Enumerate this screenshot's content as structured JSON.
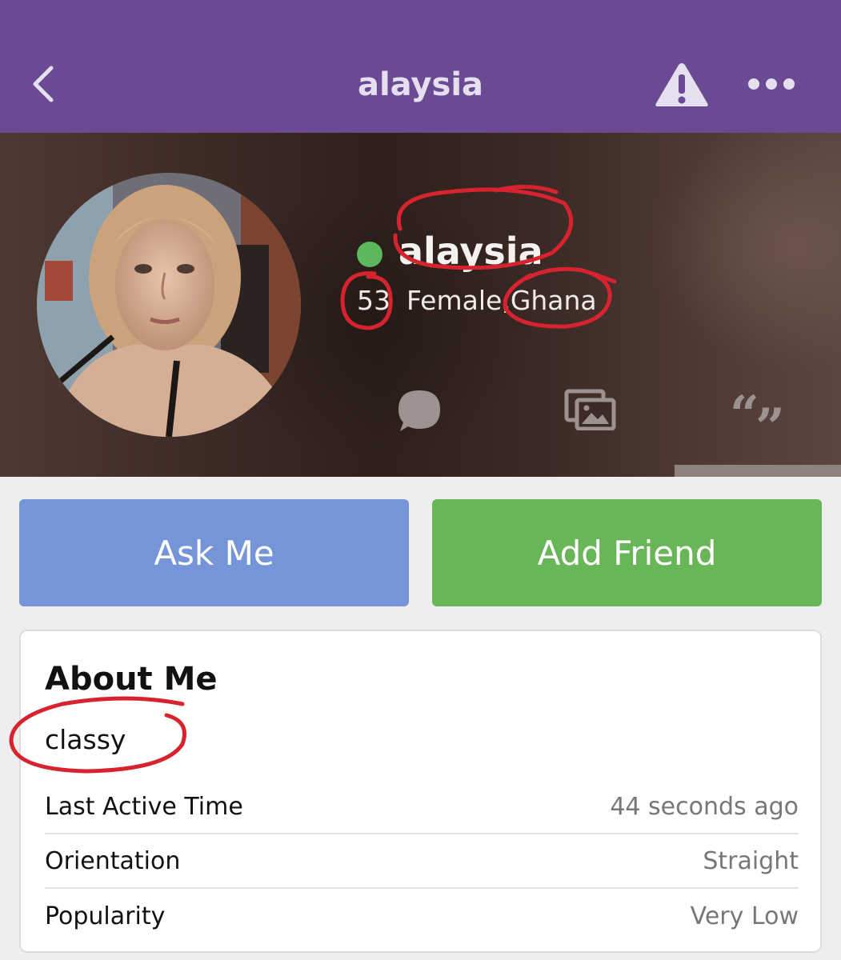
{
  "header": {
    "title": "alaysia",
    "back_icon": "chevron-left-icon",
    "report_icon": "warning-triangle-icon",
    "more_icon": "more-horizontal-icon",
    "background_color": "#6a4a93"
  },
  "profile": {
    "name": "alaysia",
    "online": true,
    "status_color": "#5cb85c",
    "age": "53",
    "gender": "Female,",
    "country": "Ghana",
    "actions": [
      {
        "icon": "chat-bubble-icon"
      },
      {
        "icon": "photos-icon"
      },
      {
        "icon": "quote-icon"
      }
    ]
  },
  "buttons": {
    "ask_me": "Ask Me",
    "add_friend": "Add Friend",
    "ask_color": "#7694d8",
    "add_color": "#69b658"
  },
  "about": {
    "title": "About Me",
    "text": "classy",
    "rows": [
      {
        "label": "Last Active Time",
        "value": "44 seconds ago"
      },
      {
        "label": "Orientation",
        "value": "Straight"
      },
      {
        "label": "Popularity",
        "value": "Very Low"
      }
    ]
  },
  "annotation_color": "#d7232f"
}
